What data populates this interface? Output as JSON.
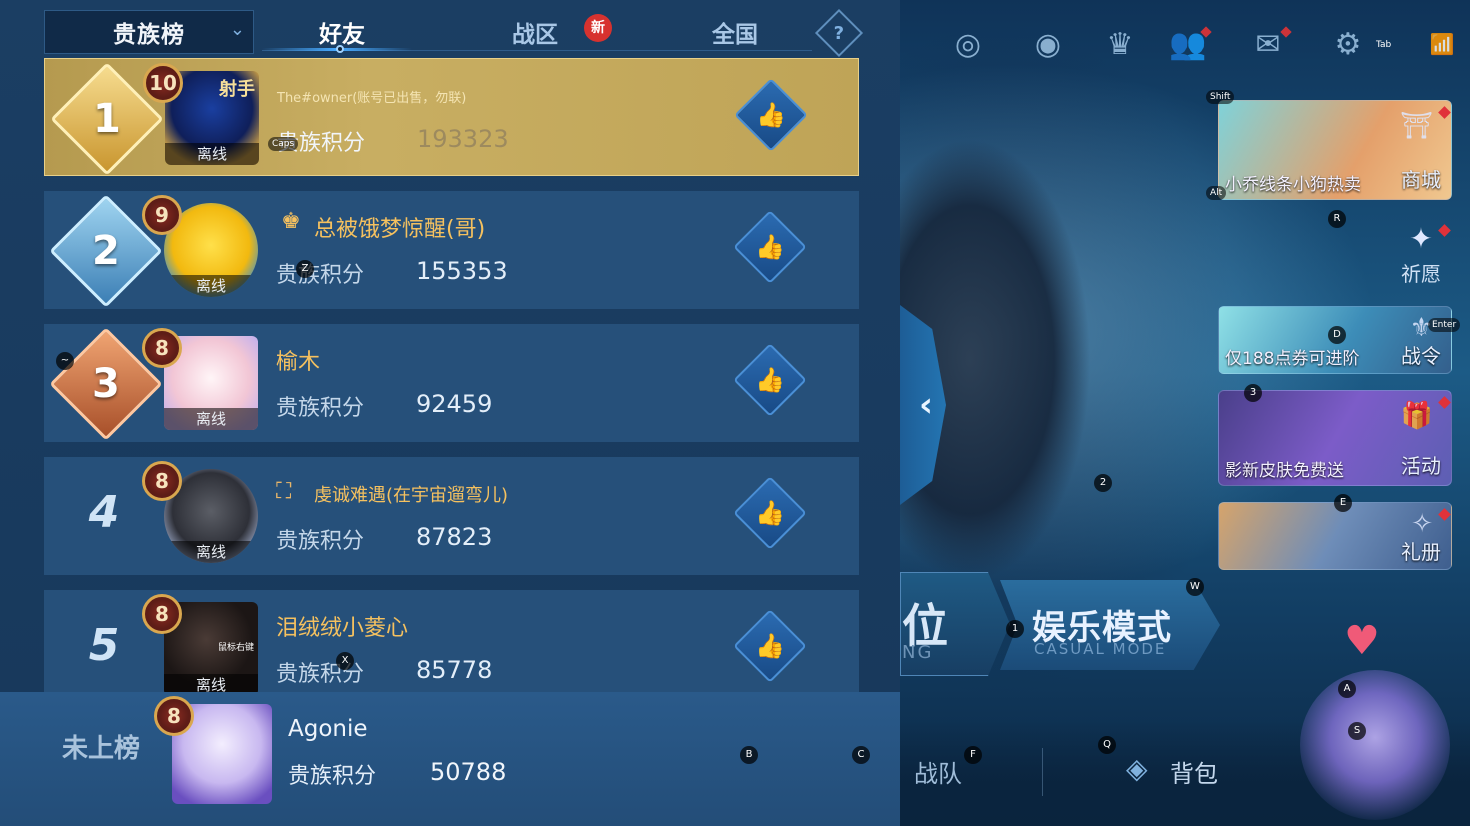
{
  "header": {
    "dropdown_label": "贵族榜",
    "tabs": [
      {
        "label": "好友",
        "active": true
      },
      {
        "label": "战区",
        "badge": "新"
      },
      {
        "label": "全国"
      }
    ],
    "help_label": "?"
  },
  "leaderboard": {
    "score_label": "贵族积分",
    "offline_label": "离线",
    "rows": [
      {
        "rank": "1",
        "level": "10",
        "name": "The#owner(账号已出售，勿联)",
        "score": "193323",
        "avatar_text": "射手"
      },
      {
        "rank": "2",
        "level": "9",
        "name": "总被饿梦惊醒(哥)",
        "score": "155353",
        "name_badge": "SVIP"
      },
      {
        "rank": "3",
        "level": "8",
        "name": "榆木",
        "score": "92459"
      },
      {
        "rank": "4",
        "level": "8",
        "name": "虔诚难遇(在宇宙遛弯儿)",
        "score": "87823"
      },
      {
        "rank": "5",
        "level": "8",
        "name": "泪绒绒小菱心",
        "score": "85778",
        "avatar_text": "鼠标右键"
      }
    ]
  },
  "my_row": {
    "rank_label": "未上榜",
    "level": "8",
    "name": "Agonie",
    "score_label": "贵族积分",
    "score": "50788"
  },
  "scene": {
    "side_cards": [
      {
        "caption": "小乔线条小狗热卖",
        "tag": "商城"
      },
      {
        "caption": "仅188点券可进阶",
        "tag": "战令"
      },
      {
        "caption": "影新皮肤免费送",
        "tag": "活动"
      },
      {
        "caption": "",
        "tag": "礼册"
      }
    ],
    "wish_label": "祈愿",
    "rank_mode_label": "位",
    "rank_mode_sub": "NG",
    "casual_mode_label": "娱乐模式",
    "casual_mode_sub": "CASUAL MODE",
    "team_label": "战队",
    "bag_label": "背包",
    "tab_key_label": "Tab"
  },
  "key_hints": {
    "caps": "Caps",
    "shift": "Shift",
    "alt": "Alt",
    "enter": "Enter",
    "r": "R",
    "d": "D",
    "three": "3",
    "two": "2",
    "e": "E",
    "w": "W",
    "one": "1",
    "a": "A",
    "s": "S",
    "q": "Q",
    "f": "F",
    "b": "B",
    "c": "C",
    "x": "X",
    "z": "Z",
    "tilde": "~"
  },
  "colors": {
    "panel_bg": "#1b3e63",
    "row_bg": "#26507a",
    "first_row_gold": "#c8ae62",
    "name_gold": "#f5c15f",
    "new_badge_red": "#d7322f"
  }
}
